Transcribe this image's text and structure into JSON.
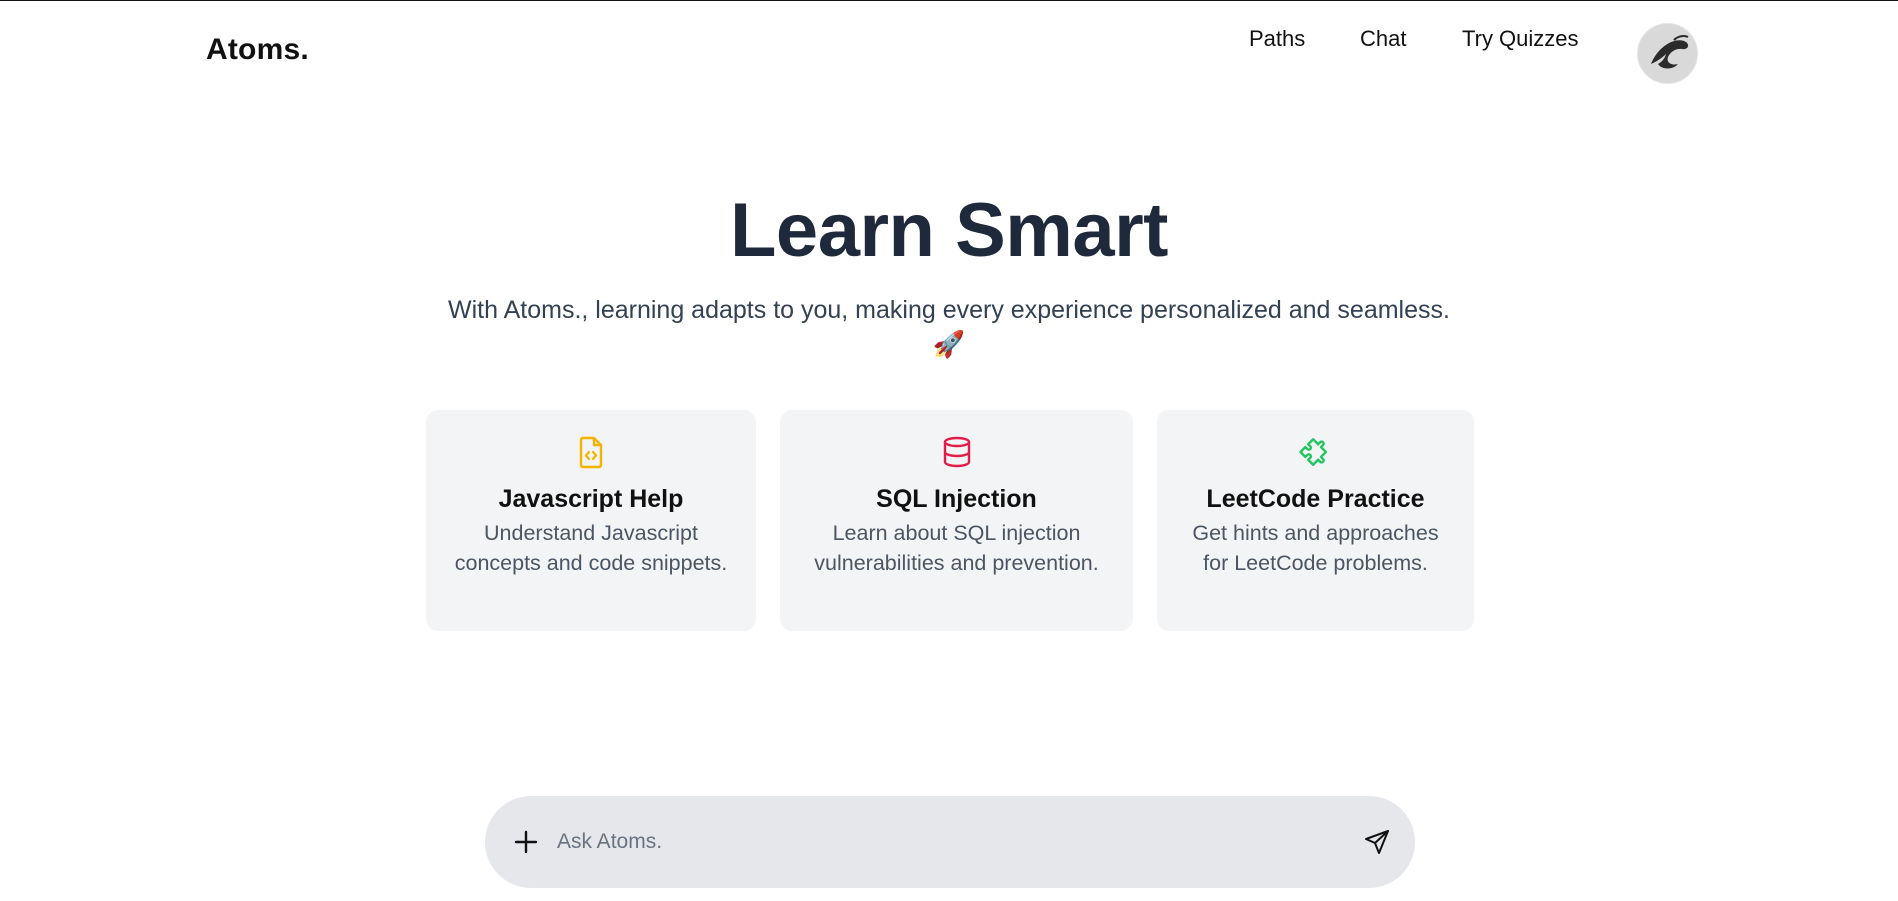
{
  "header": {
    "logo": "Atoms.",
    "nav": [
      "Paths",
      "Chat",
      "Try Quizzes"
    ]
  },
  "hero": {
    "title": "Learn Smart",
    "subtitle": "With Atoms., learning adapts to you, making every experience personalized and seamless.",
    "emoji": "🚀"
  },
  "cards": [
    {
      "icon": "file-code-icon",
      "icon_color": "#f5b300",
      "title": "Javascript Help",
      "description": "Understand Javascript concepts and code snippets."
    },
    {
      "icon": "database-icon",
      "icon_color": "#e11d48",
      "title": "SQL Injection",
      "description": "Learn about SQL injection vulnerabilities and prevention."
    },
    {
      "icon": "puzzle-icon",
      "icon_color": "#22c55e",
      "title": "LeetCode Practice",
      "description": "Get hints and approaches for LeetCode problems."
    }
  ],
  "chat": {
    "placeholder": "Ask Atoms.",
    "value": ""
  },
  "colors": {
    "title": "#1e293b",
    "card_bg": "#f3f4f6",
    "input_bg": "#e5e7eb"
  }
}
